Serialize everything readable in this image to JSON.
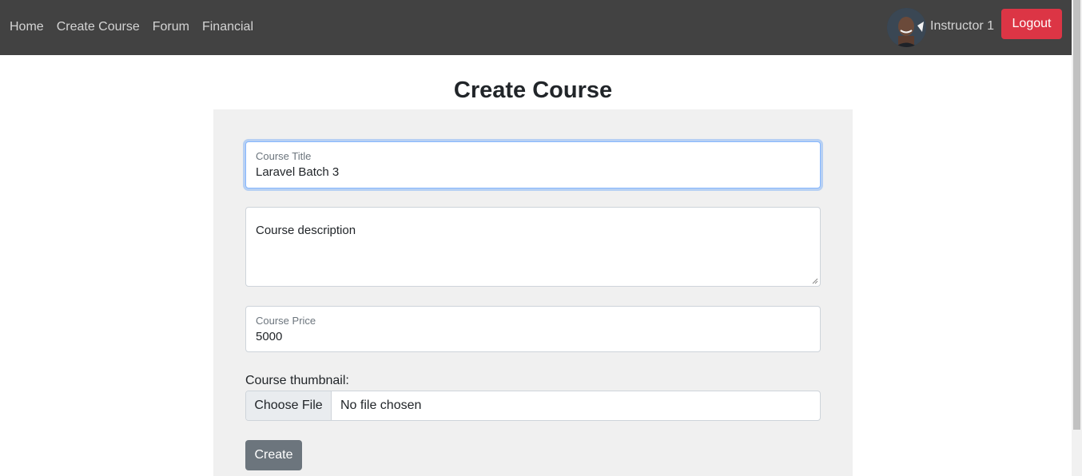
{
  "nav": {
    "links": [
      "Home",
      "Create Course",
      "Forum",
      "Financial"
    ],
    "user_name": "Instructor 1",
    "logout_label": "Logout"
  },
  "page": {
    "title": "Create Course"
  },
  "form": {
    "course_title": {
      "label": "Course Title",
      "value": "Laravel Batch 3"
    },
    "description": {
      "placeholder": "Course description"
    },
    "course_price": {
      "label": "Course Price",
      "value": "5000"
    },
    "thumbnail": {
      "label": "Course thumbnail:",
      "button": "Choose File",
      "status": "No file chosen"
    },
    "submit_label": "Create"
  },
  "colors": {
    "navbar": "#424242",
    "logout": "#dc3545",
    "submit": "#6c757d",
    "panel": "#f0f0f0",
    "focus_ring": "#86b7fe"
  }
}
